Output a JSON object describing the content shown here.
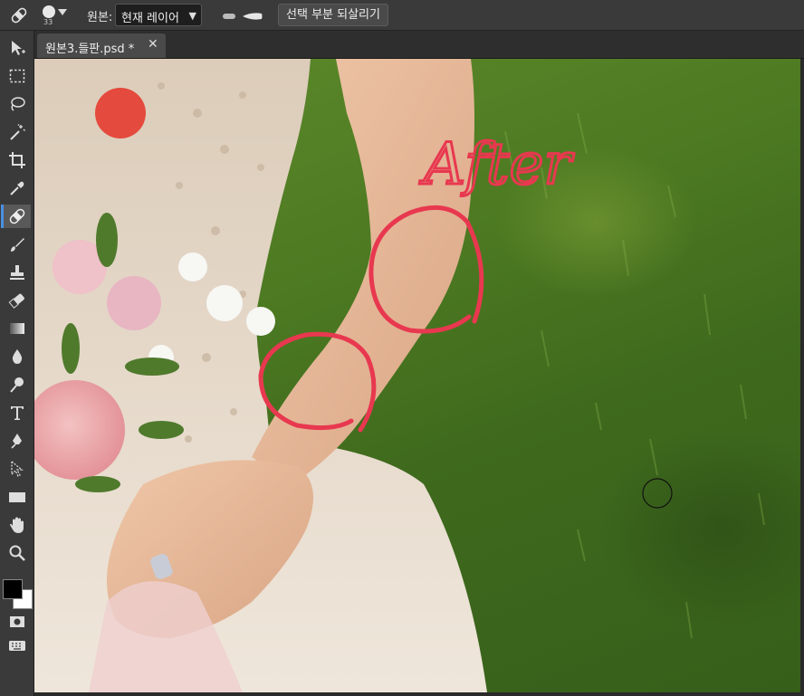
{
  "options_bar": {
    "tool_icon": "spot-healing-brush-icon",
    "brush_size": "33",
    "source_label": "원본:",
    "source_value": "현재 레이어",
    "restore_button": "선택 부분 되살리기"
  },
  "document": {
    "tab_title": "원본3.들판.psd *",
    "close_icon": "close-icon"
  },
  "canvas": {
    "annotation_text": "After",
    "annotation_color": "#e8384f"
  },
  "tools": [
    {
      "name": "move-tool",
      "icon": "move-icon"
    },
    {
      "name": "marquee-tool",
      "icon": "marquee-icon"
    },
    {
      "name": "lasso-tool",
      "icon": "lasso-icon"
    },
    {
      "name": "magic-wand-tool",
      "icon": "magic-wand-icon"
    },
    {
      "name": "crop-tool",
      "icon": "crop-icon"
    },
    {
      "name": "eyedropper-tool",
      "icon": "eyedropper-icon"
    },
    {
      "name": "healing-brush-tool",
      "icon": "bandage-icon"
    },
    {
      "name": "brush-tool",
      "icon": "brush-icon"
    },
    {
      "name": "stamp-tool",
      "icon": "stamp-icon"
    },
    {
      "name": "eraser-tool",
      "icon": "eraser-icon"
    },
    {
      "name": "gradient-tool",
      "icon": "gradient-icon"
    },
    {
      "name": "blur-tool",
      "icon": "drop-icon"
    },
    {
      "name": "dodge-tool",
      "icon": "dodge-icon"
    },
    {
      "name": "type-tool",
      "icon": "type-icon"
    },
    {
      "name": "pen-tool",
      "icon": "pen-icon"
    },
    {
      "name": "direct-select-tool",
      "icon": "direct-select-icon"
    },
    {
      "name": "rectangle-tool",
      "icon": "rectangle-icon"
    },
    {
      "name": "hand-tool",
      "icon": "hand-icon"
    },
    {
      "name": "zoom-tool",
      "icon": "zoom-icon"
    },
    {
      "name": "quick-mask-tool",
      "icon": "quick-mask-icon"
    },
    {
      "name": "keyboard-tool",
      "icon": "keyboard-icon"
    }
  ],
  "colors": {
    "foreground": "#000000",
    "background": "#ffffff",
    "accent": "#4a90e2"
  }
}
